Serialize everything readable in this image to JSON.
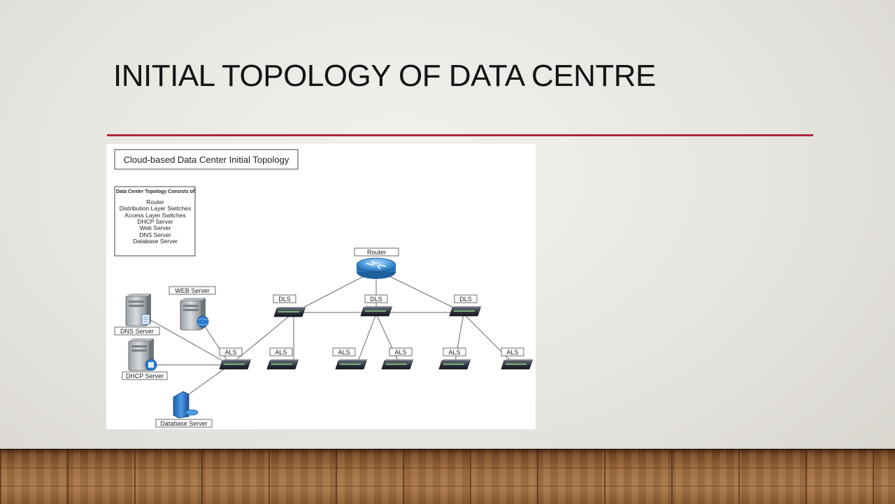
{
  "slide": {
    "title": "INITIAL TOPOLOGY OF DATA CENTRE",
    "accent_color": "#b0253a"
  },
  "diagram": {
    "title": "Cloud-based Data Center Initial Topology",
    "legend_heading": "Data Center Topology Consists of:",
    "legend_items": [
      "Router",
      "Distribution Layer Switches",
      "Access Layer Switches",
      "DHCP Server",
      "Web Server",
      "DNS Server",
      "Database Server"
    ],
    "router_label": "Router",
    "dls_labels": [
      "DLS",
      "DLS",
      "DLS"
    ],
    "als_labels": [
      "ALS",
      "ALS",
      "ALS",
      "ALS",
      "ALS",
      "ALS"
    ],
    "server_labels": {
      "web": "WEB Server",
      "dns": "DNS Server",
      "dhcp": "DHCP Server",
      "database": "Database Server"
    }
  }
}
